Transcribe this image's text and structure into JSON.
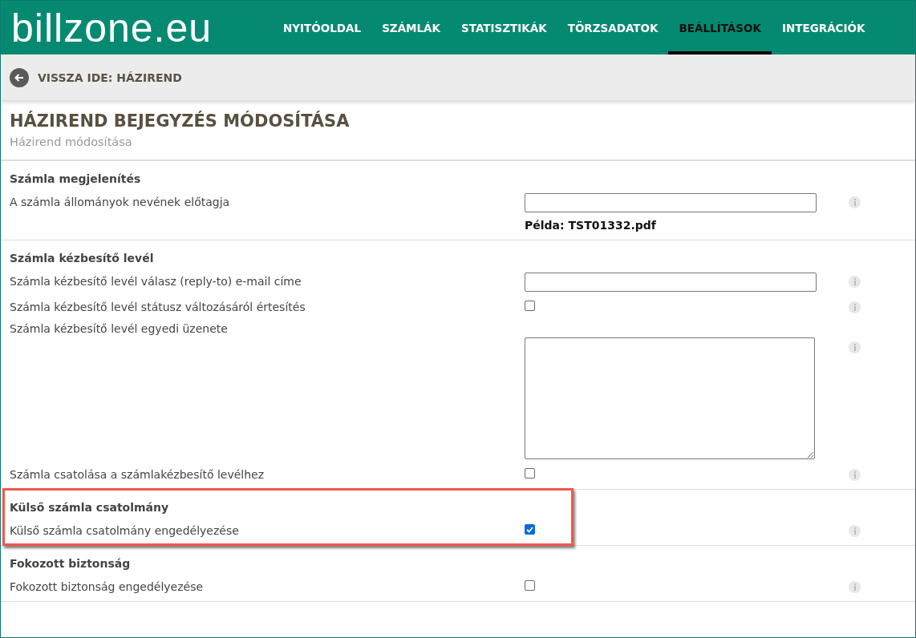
{
  "logo": "billzone.eu",
  "nav": [
    {
      "label": "NYITÓOLDAL",
      "selected": false
    },
    {
      "label": "SZÁMLÁK",
      "selected": false
    },
    {
      "label": "STATISZTIKÁK",
      "selected": false
    },
    {
      "label": "TÖRZSADATOK",
      "selected": false
    },
    {
      "label": "BEÁLLÍTÁSOK",
      "selected": true
    },
    {
      "label": "INTEGRÁCIÓK",
      "selected": false
    }
  ],
  "back_link": "VISSZA IDE: HÁZIREND",
  "title": "HÁZIREND BEJEGYZÉS MÓDOSÍTÁSA",
  "subtitle": "Házirend módosítása",
  "sections": [
    {
      "heading": "Számla megjelenítés",
      "highlighted": false,
      "rows": [
        {
          "kind": "text",
          "label": "A számla állományok nevének előtagja",
          "hint": "Példa: TST01332.pdf"
        }
      ]
    },
    {
      "heading": "Számla kézbesítő levél",
      "highlighted": false,
      "rows": [
        {
          "kind": "text",
          "label": "Számla kézbesítő levél válasz (reply-to) e-mail címe"
        },
        {
          "kind": "checkbox",
          "label": "Számla kézbesítő levél státusz változásáról értesítés",
          "checked": false
        },
        {
          "kind": "textarea",
          "label": "Számla kézbesítő levél egyedi üzenete"
        },
        {
          "kind": "checkbox",
          "label": "Számla csatolása a számlakézbesítő levélhez",
          "checked": false
        }
      ]
    },
    {
      "heading": "Külső számla csatolmány",
      "highlighted": true,
      "rows": [
        {
          "kind": "checkbox",
          "label": "Külső számla csatolmány engedélyezése",
          "checked": true
        }
      ]
    },
    {
      "heading": "Fokozott biztonság",
      "highlighted": false,
      "rows": [
        {
          "kind": "checkbox",
          "label": "Fokozott biztonság engedélyezése",
          "checked": false
        }
      ]
    }
  ]
}
